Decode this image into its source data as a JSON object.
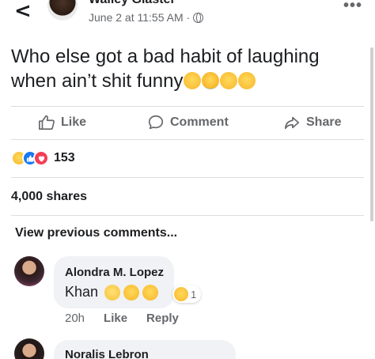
{
  "header": {
    "back_icon": "chevron-left-icon",
    "author": "Walley Glaster",
    "date": "June 2 at 11:55 AM",
    "separator": "·",
    "privacy_icon": "globe-icon",
    "more_icon": "more-dots-icon",
    "more_glyph": "•••"
  },
  "post": {
    "text": "Who else got a bad habit of laughing when ain’t shit funny",
    "emojis": [
      "woozy-face",
      "loudly-crying-face",
      "tears-of-joy-face",
      "tears-of-joy-face"
    ]
  },
  "actions": {
    "like_label": "Like",
    "comment_label": "Comment",
    "share_label": "Share"
  },
  "reactions": {
    "types": [
      "haha",
      "like",
      "love"
    ],
    "count": "153"
  },
  "shares": "4,000 shares",
  "view_previous": "View previous comments...",
  "comments": [
    {
      "name": "Alondra M. Lopez",
      "text": "Khan",
      "emojis": [
        "face-with-rolling-eyes",
        "tears-of-joy-face",
        "tears-of-joy-face"
      ],
      "reaction_count": "1",
      "time": "20h",
      "like_label": "Like",
      "reply_label": "Reply"
    },
    {
      "name": "Noralis Lebron"
    }
  ],
  "colors": {
    "text": "#1c1e21",
    "secondary": "#65676b",
    "bubble": "#f0f2f5",
    "like_blue": "#1877f2",
    "love_red": "#f33e58",
    "divider": "#dadde1"
  }
}
